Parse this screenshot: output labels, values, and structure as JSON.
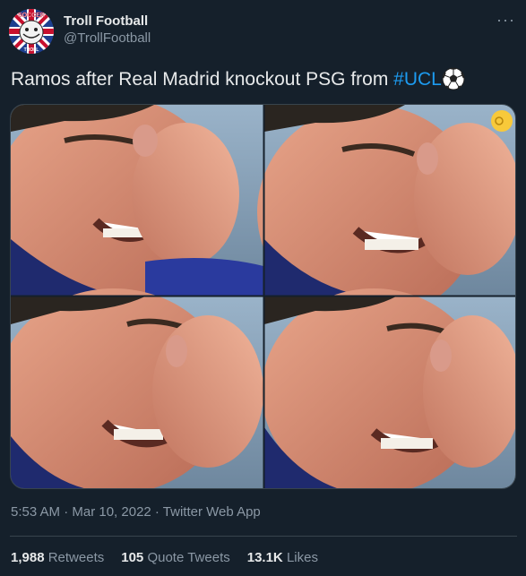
{
  "tweet": {
    "display_name": "Troll Football",
    "handle": "@TrollFootball",
    "avatar_text_top": "SOCCER",
    "avatar_text_bottom": "TROLL",
    "text_main": "Ramos after Real Madrid knockout PSG from ",
    "hashtag": "#UCL",
    "timestamp": "5:53 AM · Mar 10, 2022 · Twitter Web App"
  },
  "stats": {
    "retweets_count": "1,988",
    "retweets_label": "Retweets",
    "quotes_count": "105",
    "quotes_label": "Quote Tweets",
    "likes_count": "13.1K",
    "likes_label": "Likes"
  },
  "colors": {
    "background": "#15202b",
    "hashtag": "#1d9bf0",
    "secondary_text": "#8b98a5",
    "divider": "#38444d"
  }
}
